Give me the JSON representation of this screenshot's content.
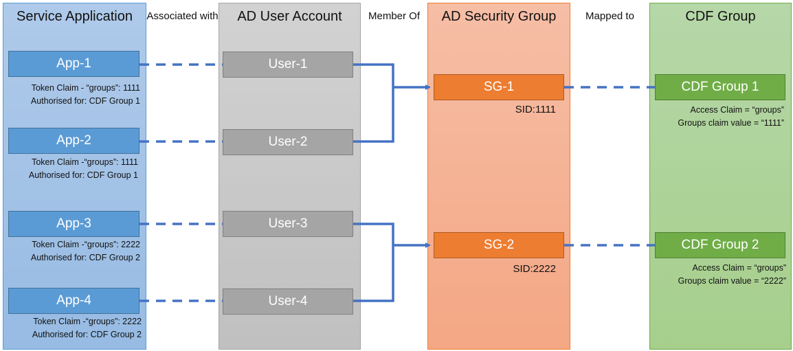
{
  "columns": [
    {
      "title": "Service Application",
      "color": "#9dc3e6"
    },
    {
      "title": "AD User Account",
      "color": "#c9c9c9"
    },
    {
      "title": "AD Security Group",
      "color": "#f4b183"
    },
    {
      "title": "CDF Group",
      "color": "#a9d18e"
    }
  ],
  "relations": {
    "associated": "Associated with",
    "member_of": "Member Of",
    "mapped_to": "Mapped to"
  },
  "apps": [
    {
      "label": "App-1",
      "claim": "Token Claim - “groups”: 1111",
      "authorised": "Authorised for: CDF Group 1"
    },
    {
      "label": "App-2",
      "claim": "Token Claim -“groups”: 1111",
      "authorised": "Authorised for: CDF Group 1"
    },
    {
      "label": "App-3",
      "claim": "Token Claim -“groups”: 2222",
      "authorised": "Authorised for: CDF Group 2"
    },
    {
      "label": "App-4",
      "claim": "Token Claim -“groups”: 2222",
      "authorised": "Authorised for: CDF Group 2"
    }
  ],
  "users": [
    {
      "label": "User-1"
    },
    {
      "label": "User-2"
    },
    {
      "label": "User-3"
    },
    {
      "label": "User-4"
    }
  ],
  "security_groups": [
    {
      "label": "SG-1",
      "sid": "SID:1111"
    },
    {
      "label": "SG-2",
      "sid": "SID:2222"
    }
  ],
  "cdf_groups": [
    {
      "label": "CDF Group 1",
      "access_claim": "Access Claim = “groups”",
      "claim_value": "Groups claim value = “1111”"
    },
    {
      "label": "CDF Group 2",
      "access_claim": "Access Claim = “groups”",
      "claim_value": "Groups claim value = “2222”"
    }
  ],
  "connector_color": "#4472c4"
}
